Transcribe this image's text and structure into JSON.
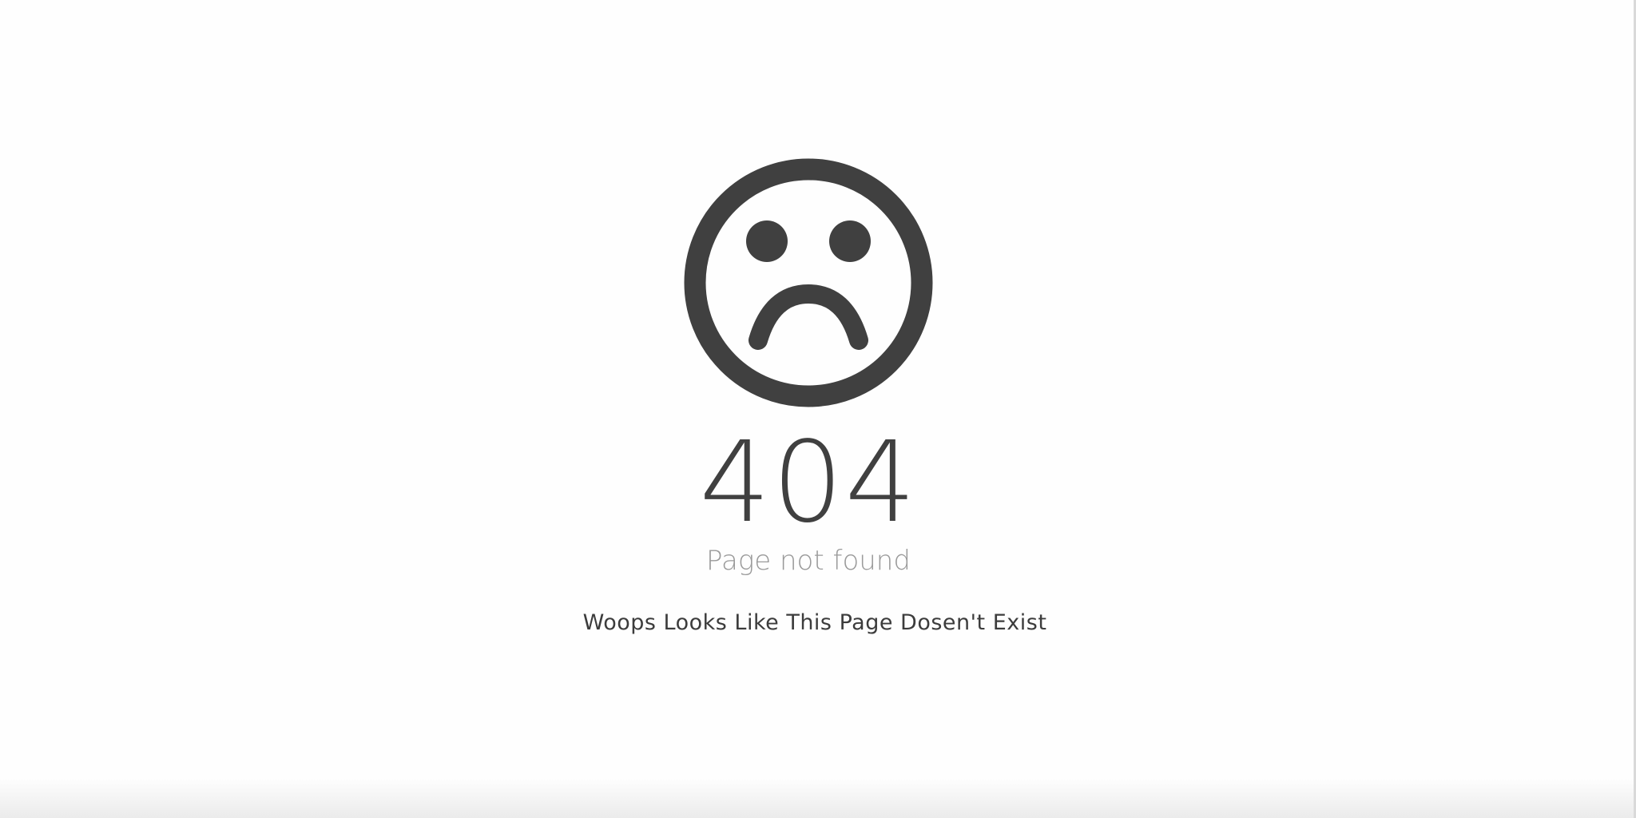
{
  "error": {
    "icon": "sad-face-icon",
    "code": "404",
    "subtitle": "Page not found",
    "message": "Woops Looks Like This Page Dosen't Exist"
  },
  "colors": {
    "icon": "#404040",
    "code": "#404040",
    "subtitle": "#9a9a9a",
    "message": "#3c3c3c",
    "background": "#fefefe"
  }
}
